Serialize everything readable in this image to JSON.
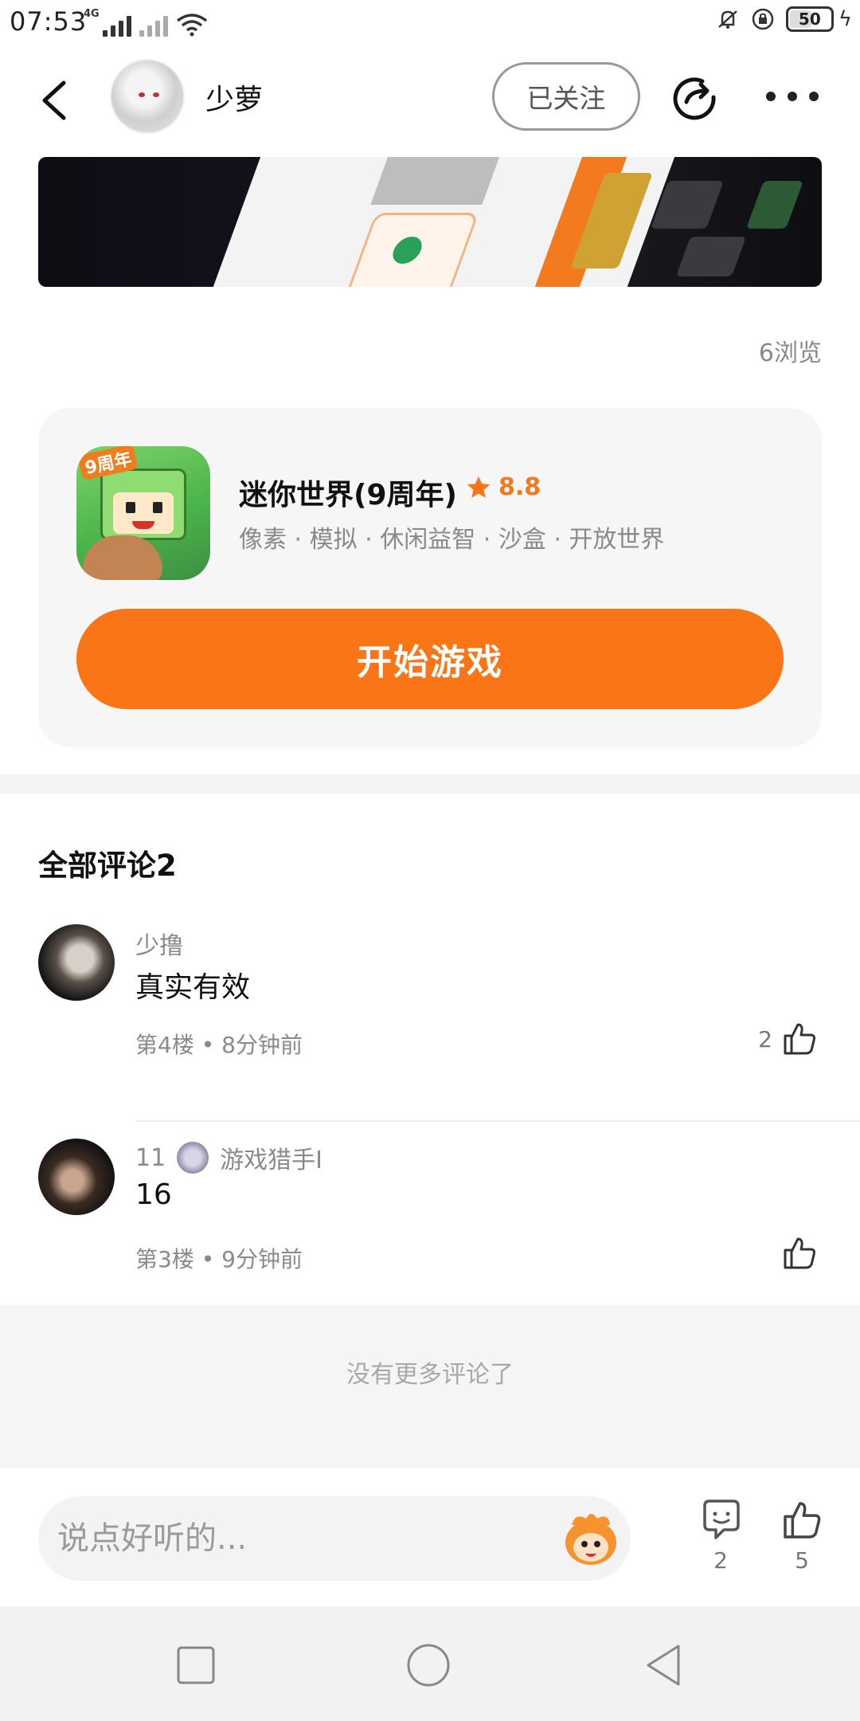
{
  "status_bar": {
    "time": "07:53",
    "net1": "4G",
    "battery": "50",
    "battery_level": 0.5
  },
  "header": {
    "nickname": "少萝",
    "follow_label": "已关注"
  },
  "post": {
    "views": "6浏览"
  },
  "game_card": {
    "name": "迷你世界(9周年)",
    "rating": "8.8",
    "tags": "像素 · 模拟 · 休闲益智 · 沙盒 · 开放世界",
    "icon_badge": "9周年",
    "play_label": "开始游戏",
    "accent": "#f97516"
  },
  "comments": {
    "title": "全部评论2",
    "items": [
      {
        "user": "少撸",
        "text": "真实有效",
        "floor": "第4楼",
        "time": "8分钟前",
        "likes": "2"
      },
      {
        "user": "11",
        "badge_name": "游戏猎手I",
        "text": "16",
        "floor": "第3楼",
        "time": "9分钟前",
        "likes": ""
      }
    ],
    "no_more": "没有更多评论了"
  },
  "input_bar": {
    "placeholder": "说点好听的...",
    "comment_count": "2",
    "like_count": "5"
  },
  "icons": {
    "back": "back-arrow-icon",
    "share": "share-icon",
    "more": "more-dots-icon",
    "star": "star-icon",
    "like": "thumbs-up-icon",
    "comment": "comment-bubble-icon"
  }
}
